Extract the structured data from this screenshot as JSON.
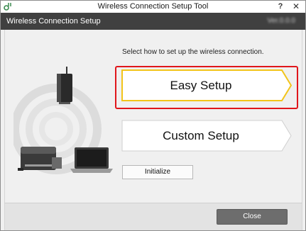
{
  "window": {
    "title": "Wireless Connection Setup Tool",
    "help_label": "?",
    "close_label": "✕"
  },
  "header": {
    "title": "Wireless Connection Setup",
    "version": "Ver.0.0.0"
  },
  "main": {
    "instruction": "Select how to set up the wireless connection.",
    "easy_setup_label": "Easy Setup",
    "custom_setup_label": "Custom Setup",
    "initialize_label": "Initialize"
  },
  "footer": {
    "close_label": "Close"
  },
  "colors": {
    "header_bg": "#404040",
    "highlight": "#e0161b",
    "selected_border": "#f2c41a",
    "close_button": "#6d6d6d"
  }
}
